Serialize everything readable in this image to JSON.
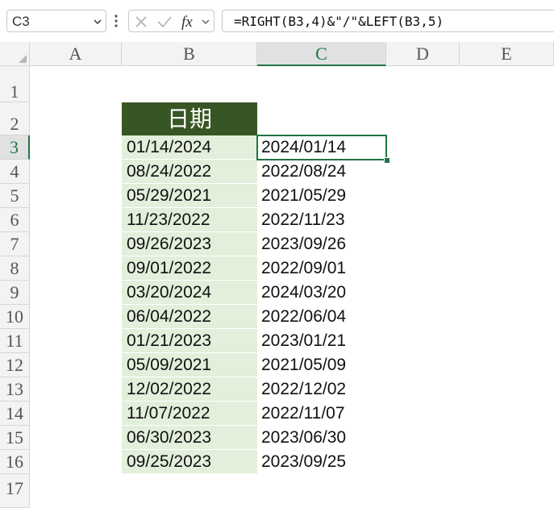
{
  "formula_bar": {
    "name_box": "C3",
    "formula": "=RIGHT(B3,4)&\"/\"&LEFT(B3,5)",
    "cancel_icon": "x-icon",
    "enter_icon": "check-icon",
    "function_icon": "fx-icon"
  },
  "columns": [
    "A",
    "B",
    "C",
    "D",
    "E"
  ],
  "selected_column": "C",
  "rows": [
    "1",
    "2",
    "3",
    "4",
    "5",
    "6",
    "7",
    "8",
    "9",
    "10",
    "11",
    "12",
    "13",
    "14",
    "15",
    "16",
    "17"
  ],
  "selected_row": "3",
  "header_cell": "日期",
  "colors": {
    "header_fill": "#375623",
    "data_fill": "#e2efda",
    "selection": "#217346"
  },
  "data": [
    {
      "b": "01/14/2024",
      "c": "2024/01/14"
    },
    {
      "b": "08/24/2022",
      "c": "2022/08/24"
    },
    {
      "b": "05/29/2021",
      "c": "2021/05/29"
    },
    {
      "b": "11/23/2022",
      "c": "2022/11/23"
    },
    {
      "b": "09/26/2023",
      "c": "2023/09/26"
    },
    {
      "b": "09/01/2022",
      "c": "2022/09/01"
    },
    {
      "b": "03/20/2024",
      "c": "2024/03/20"
    },
    {
      "b": "06/04/2022",
      "c": "2022/06/04"
    },
    {
      "b": "01/21/2023",
      "c": "2023/01/21"
    },
    {
      "b": "05/09/2021",
      "c": "2021/05/09"
    },
    {
      "b": "12/02/2022",
      "c": "2022/12/02"
    },
    {
      "b": "11/07/2022",
      "c": "2022/11/07"
    },
    {
      "b": "06/30/2023",
      "c": "2023/06/30"
    },
    {
      "b": "09/25/2023",
      "c": "2023/09/25"
    }
  ]
}
